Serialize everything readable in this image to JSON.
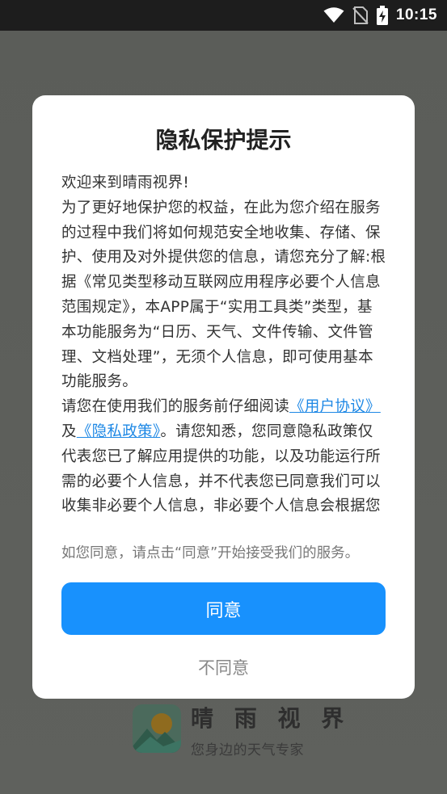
{
  "status_bar": {
    "time": "10:15",
    "icons": [
      "wifi-icon",
      "no-sim-icon",
      "battery-charging-icon"
    ]
  },
  "dialog": {
    "title": "隐私保护提示",
    "body": {
      "greeting": "欢迎来到晴雨视界!",
      "paragraph1": "为了更好地保护您的权益，在此为您介绍在服务的过程中我们将如何规范安全地收集、存储、保护、使用及对外提供您的信息，请您充分了解:根据《常见类型移动互联网应用程序必要个人信息范围规定》，本APP属于“实用工具类”类型，基本功能服务为“日历、天气、文件传输、文件管理、文档处理”，无须个人信息，即可使用基本功能服务。",
      "p2_before_link1": "请您在使用我们的服务前仔细阅读",
      "user_agreement_link": "《用户协议》",
      "p2_and": "及",
      "privacy_policy_link": "《隐私政策》",
      "p2_after_link2": "。请您知悉，您同意隐私政策仅代表您已了解应用提供的功能，以及功能运行所需的必要个人信息，并不代表您已同意我们可以收集非必要个人信息，非必要个人信息会根据您"
    },
    "hint": "如您同意，请点击“同意”开始接受我们的服务。",
    "agree_label": "同意",
    "disagree_label": "不同意"
  },
  "splash": {
    "app_name": "晴 雨 视 界",
    "slogan": "您身边的天气专家"
  },
  "colors": {
    "accent": "#1891fd",
    "link": "#1e88e5",
    "overlay": "#5c5e5a"
  }
}
